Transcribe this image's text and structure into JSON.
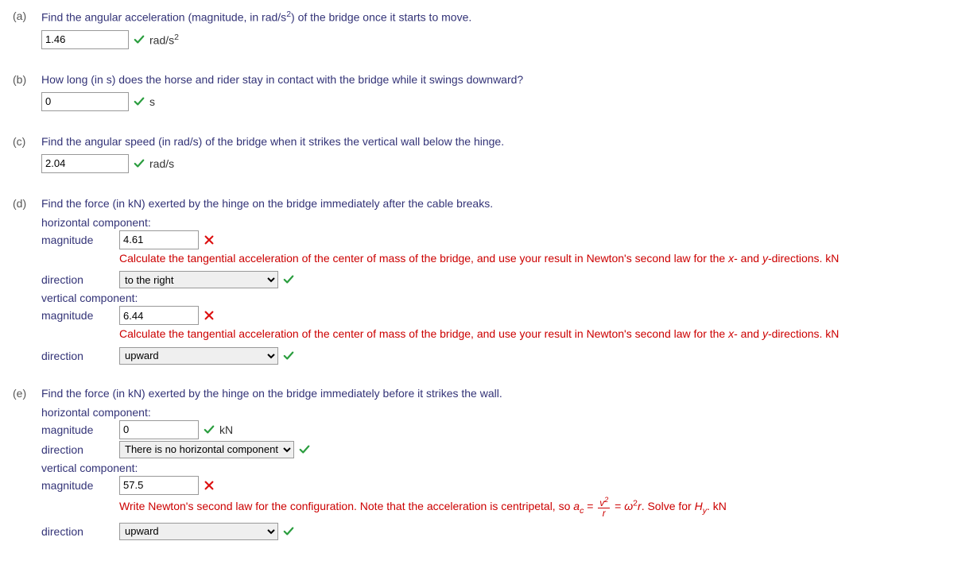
{
  "a": {
    "label": "(a)",
    "prompt_pre": "Find the angular acceleration (magnitude, in rad/s",
    "prompt_sup": "2",
    "prompt_post": ") of the bridge once it starts to move.",
    "value": "1.46",
    "unit_pre": "rad/s",
    "unit_sup": "2"
  },
  "b": {
    "label": "(b)",
    "prompt": "How long (in s) does the horse and rider stay in contact with the bridge while it swings downward?",
    "value": "0",
    "unit": "s"
  },
  "c": {
    "label": "(c)",
    "prompt": "Find the angular speed (in rad/s) of the bridge when it strikes the vertical wall below the hinge.",
    "value": "2.04",
    "unit": "rad/s"
  },
  "d": {
    "label": "(d)",
    "prompt": "Find the force (in kN) exerted by the hinge on the bridge immediately after the cable breaks.",
    "horiz_heading": "horizontal component:",
    "vert_heading": "vertical component:",
    "mag_label": "magnitude",
    "dir_label": "direction",
    "h_mag": "4.61",
    "h_feedback_pre": "Calculate the tangential acceleration of the center of mass of the bridge, and use your result in Newton's second law for the ",
    "h_feedback_x": "x",
    "h_feedback_mid": "- and ",
    "h_feedback_y": "y",
    "h_feedback_post": "-directions. kN",
    "h_dir": "to the right",
    "v_mag": "6.44",
    "v_dir": "upward"
  },
  "e": {
    "label": "(e)",
    "prompt": "Find the force (in kN) exerted by the hinge on the bridge immediately before it strikes the wall.",
    "horiz_heading": "horizontal component:",
    "vert_heading": "vertical component:",
    "mag_label": "magnitude",
    "dir_label": "direction",
    "h_mag": "0",
    "h_unit": "kN",
    "h_dir": "There is no horizontal component.",
    "v_mag": "57.5",
    "v_feedback_1": "Write Newton's second law for the configuration. Note that the acceleration is centripetal, so ",
    "v_feedback_ac_a": "a",
    "v_feedback_ac_c": "c",
    "v_feedback_eq": " = ",
    "v_feedback_num_v": "v",
    "v_feedback_num_sup": "2",
    "v_feedback_den": "r",
    "v_feedback_eq2": " = ",
    "v_feedback_omega": "ω",
    "v_feedback_omega_sup": "2",
    "v_feedback_r": "r",
    "v_feedback_2": ". Solve for ",
    "v_feedback_H": "H",
    "v_feedback_Hy": "y",
    "v_feedback_3": ". kN",
    "v_dir": "upward"
  }
}
